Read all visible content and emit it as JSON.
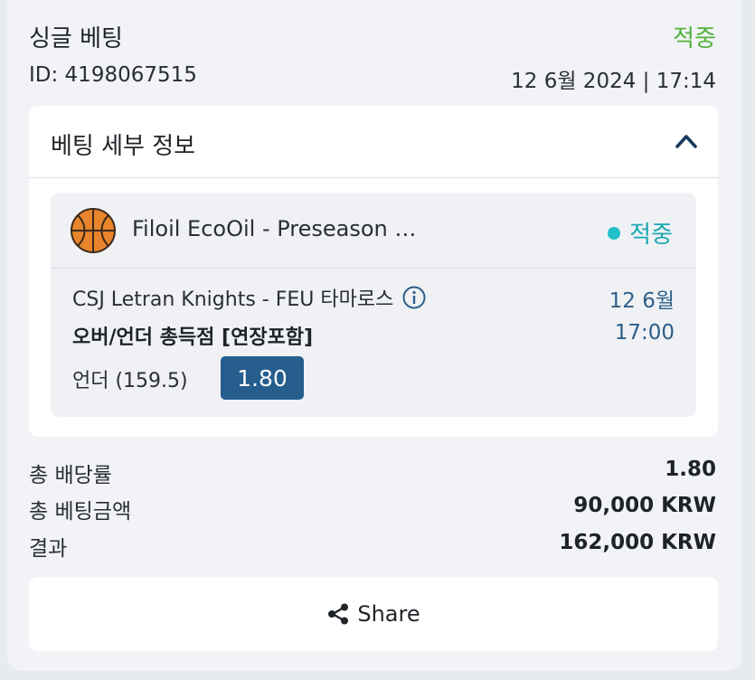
{
  "header": {
    "title": "싱글 베팅",
    "status": "적중",
    "id_text": "ID: 4198067515",
    "datetime": "12 6월 2024 | 17:14"
  },
  "details": {
    "title": "베팅 세부 정보",
    "toggle_icon": "chevron-up-icon",
    "bet": {
      "sport_icon": "basketball-icon",
      "league": "Filoil EcoOil - Preseason …",
      "status": "적중",
      "teams": "CSJ Letran Knights - FEU 타마로스",
      "date": "12 6월",
      "time": "17:00",
      "market": "오버/언더 총득점 [연장포함]",
      "selection": "언더 (159.5)",
      "odds": "1.80"
    }
  },
  "summary": {
    "total_odds_label": "총 배당률",
    "total_odds_value": "1.80",
    "stake_label": "총 베팅금액",
    "stake_value": "90,000 KRW",
    "result_label": "결과",
    "result_value": "162,000 KRW"
  },
  "share": {
    "label": "Share",
    "icon": "share-icon"
  },
  "colors": {
    "win_green": "#52b33b",
    "win_teal": "#1fc0c8",
    "odds_blue": "#255d8d",
    "date_blue": "#2d5f8a"
  }
}
